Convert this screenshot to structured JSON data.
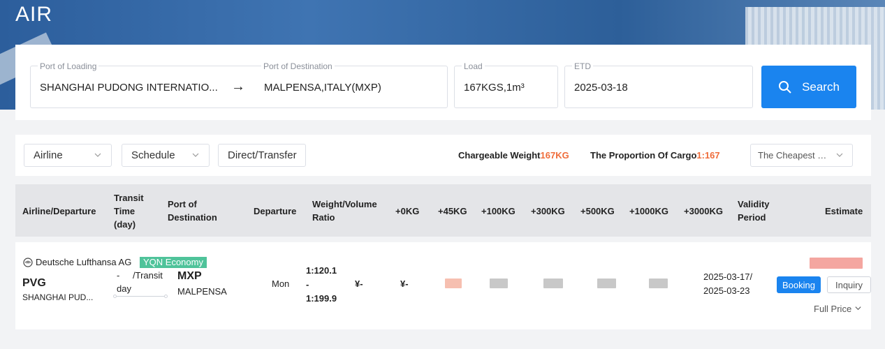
{
  "page": {
    "title": "AIR"
  },
  "search": {
    "port_of_loading_label": "Port of Loading",
    "port_of_loading_value": "SHANGHAI PUDONG INTERNATIO...",
    "arrow": "→",
    "port_of_destination_label": "Port of Destination",
    "port_of_destination_value": "MALPENSA,ITALY(MXP)",
    "load_label": "Load",
    "load_value": "167KGS,1m³",
    "etd_label": "ETD",
    "etd_value": "2025-03-18",
    "search_button": "Search"
  },
  "filters": {
    "airline": "Airline",
    "schedule": "Schedule",
    "direct_transfer": "Direct/Transfer",
    "chargeable_weight_label": "Chargeable Weight",
    "chargeable_weight_value": "167KG",
    "proportion_label": "The Proportion Of Cargo",
    "proportion_value": "1:167",
    "sort": "The Cheapest P..."
  },
  "table": {
    "headers": {
      "airline_departure": "Airline/Departure",
      "transit_time_1": "Transit",
      "transit_time_2": "Time",
      "transit_time_3": "(day)",
      "port_dest_1": "Port of",
      "port_dest_2": "Destination",
      "departure": "Departure",
      "wv_ratio_1": "Weight/Volume",
      "wv_ratio_2": "Ratio",
      "kg0": "+0KG",
      "kg45": "+45KG",
      "kg100": "+100KG",
      "kg300": "+300KG",
      "kg500": "+500KG",
      "kg1000": "+1000KG",
      "kg3000": "+3000KG",
      "validity_1": "Validity",
      "validity_2": "Period",
      "estimate": "Estimate"
    },
    "row": {
      "airline": "Deutsche Lufthansa AG",
      "badge": "YQN Economy",
      "origin_code": "PVG",
      "origin_name": "SHANGHAI PUD...",
      "transit_a": "-",
      "transit_b": "/Transit",
      "transit_c": "day",
      "dest_code": "MXP",
      "dest_name": "MALPENSA",
      "departure_day": "Mon",
      "ratio_1": "1:120.1",
      "ratio_2": "-",
      "ratio_3": "1:199.9",
      "price_0": "¥-",
      "price_45": "¥-",
      "validity_1": "2025-03-17/",
      "validity_2": "2025-03-23",
      "booking": "Booking",
      "inquiry": "Inquiry",
      "full_price": "Full Price"
    }
  },
  "colors": {
    "accent": "#1a84ef",
    "highlight": "#ef6c3a",
    "badge": "#4fc39a"
  }
}
